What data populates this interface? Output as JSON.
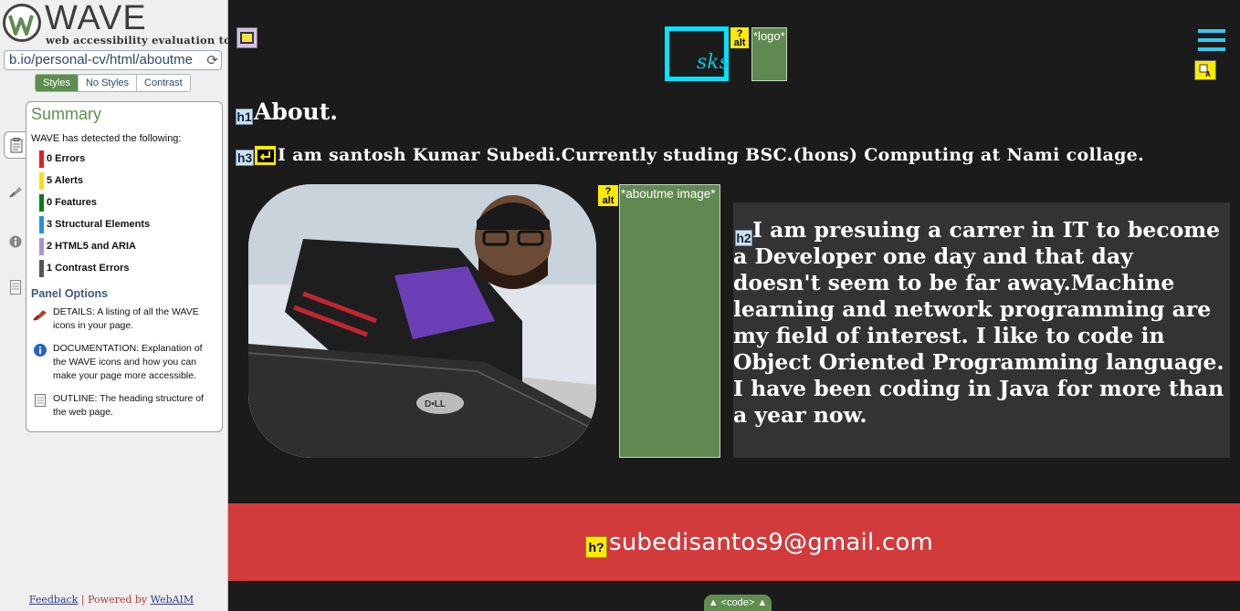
{
  "wave": {
    "title": "WAVE",
    "subtitle": "web accessibility evaluation tool",
    "url": "b.io/personal-cv/html/aboutme",
    "view_tabs": [
      "Styles",
      "No Styles",
      "Contrast"
    ],
    "summary": {
      "heading": "Summary",
      "detected": "WAVE has detected the following:",
      "items": [
        {
          "label": "0 Errors",
          "color": "#e21f1f"
        },
        {
          "label": "5 Alerts",
          "color": "#f5e400"
        },
        {
          "label": "0 Features",
          "color": "#0f7a19"
        },
        {
          "label": "3 Structural Elements",
          "color": "#2b8fd6"
        },
        {
          "label": "2 HTML5 and ARIA",
          "color": "#b18fd4"
        },
        {
          "label": "1 Contrast Errors",
          "color": "#555555"
        }
      ]
    },
    "panel_options": {
      "heading": "Panel Options",
      "details": "DETAILS: A listing of all the WAVE icons in your page.",
      "documentation": "DOCUMENTATION: Explanation of the WAVE icons and how you can make your page more accessible.",
      "outline": "OUTLINE: The heading structure of the web page."
    },
    "footer": {
      "feedback": "Feedback",
      "separator": "|",
      "powered": "Powered by",
      "webaim": "WebAIM"
    },
    "code_tab": "<code>"
  },
  "page": {
    "logo_text": "sks",
    "logo_alt": "*logo*",
    "h1": "About.",
    "h3": "I am santosh Kumar Subedi.Currently studing BSC.(hons) Computing at Nami collage.",
    "image_alt": "*aboutme image*",
    "bio": "I am presuing a carrer in IT to become a Developer one day and that day doesn't seem to be far away.Machine learning and network programming are my field of interest. I like to code in Object Oriented Programming language. I have been coding in Java for more than a year now.",
    "email": "subedisantos9@gmail.com"
  },
  "icons": {
    "h1": "h1",
    "h2": "h2",
    "h3": "h3",
    "hq": "h?",
    "alt_q": "?",
    "alt": "alt"
  },
  "colors": {
    "wave_green": "#5f8d50",
    "page_bg": "#1b1b1b",
    "logo_border": "#00e5ff",
    "hamburger": "#39c8f2",
    "footer_bg": "#d13b3c",
    "alert_yellow": "#ffea00"
  }
}
